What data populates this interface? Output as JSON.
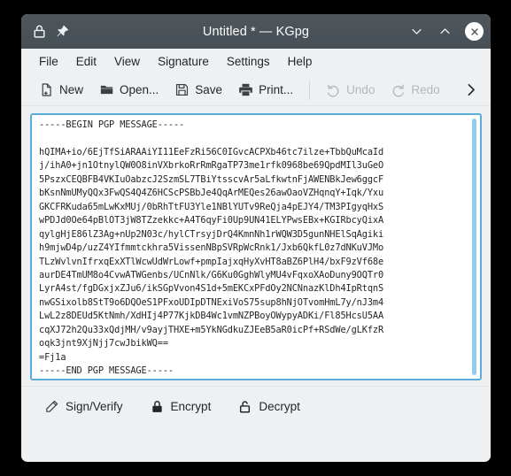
{
  "window": {
    "title": "Untitled * — KGpg",
    "titlebar_icons": [
      "lock-icon",
      "pin-icon"
    ],
    "controls": {
      "minimize": "chevron-down-icon",
      "maximize": "chevron-up-icon",
      "close": "close-icon"
    }
  },
  "menubar": {
    "items": [
      {
        "label": "File"
      },
      {
        "label": "Edit"
      },
      {
        "label": "View"
      },
      {
        "label": "Signature"
      },
      {
        "label": "Settings"
      },
      {
        "label": "Help"
      }
    ]
  },
  "toolbar": {
    "items": [
      {
        "label": "New",
        "icon": "new-document-icon",
        "enabled": true
      },
      {
        "label": "Open...",
        "icon": "folder-open-icon",
        "enabled": true
      },
      {
        "label": "Save",
        "icon": "floppy-disk-icon",
        "enabled": true
      },
      {
        "label": "Print...",
        "icon": "printer-icon",
        "enabled": true
      },
      {
        "label": "Undo",
        "icon": "undo-arrow-icon",
        "enabled": false
      },
      {
        "label": "Redo",
        "icon": "redo-arrow-icon",
        "enabled": false
      }
    ],
    "overflow_icon": "chevron-right-icon"
  },
  "editor": {
    "content": "-----BEGIN PGP MESSAGE-----\n\nhQIMA+io/6EjTfSiARAAiYI11EeFzRi56C0IGvcACPXb46tc7ilze+TbbQuMcaId\nj/ihA0+jn1OtnylQW0O8inVXbrkoRrRmRgaTP73me1rfk0968be69QpdMIl3uGeO\n5PszxCEQBFB4VKIuOabzcJ2SzmSL7TBiYtsscvAr5aLfkwtnFjAWENBkJew6ggcF\nbKsnNmUMyQQx3FwQS4Q4Z6HCScPSBbJe4QqArMEQes26awOaoVZHqnqY+Iqk/Yxu\nGKCFRKuda65mLwKxMUj/0bRhTtFU3Yle1NBlYUTv9ReQja4pEJY4/TM3PIgyqHxS\nwPDJd0Oe64pBlOT3jW8TZzekkc+A4T6qyFi0Up9UN41ELYPwsEBx+KGIRbcyQixA\nqylgHjE86lZ3Ag+nUp2N03c/hylCTrsyjDrQ4KmnNh1rWQW3D5gunNHElSqAgiki\nh9mjwD4p/uzZ4YIfmmtckhra5VissenNBpSVRpWcRnk1/Jxb6QkfL0z7dNKuVJMo\nTLzWvlvnIfrxqExXTlWcwUdWrLowf+pmpIajxqHyXvHT8aBZ6PlH4/bxF9zVf68e\naurDE4TmUM8o4CvwATWGenbs/UCnNlk/G6Ku0GghWlyMU4vFqxoXAoDuny9OQTr0\nLyrA4st/fgDGxjxZJu6/ikSGpVvon4S1d+5mEKCxPFdOy2NCNnazKlDh4IpRtqnS\nnwGSixolb8StT9o6DQOeS1PFxoUDIpDTNExiVoS75sup8hNjOTvomHmL7y/nJ3m4\nLwL2z8DEUd5KtNmh/XdHIj4P77KjkDB4Wc1vmNZPBoyOWypyADKi/Fl85HcsU5AA\ncqXJ72h2Qu33xQdjMH/v9ayjTHXE+m5YkNGdkuZJEeB5aR0icPf+RSdWe/gLKfzR\noqk3jnt9XjNjj7cwJbikWQ==\n=Fj1a\n-----END PGP MESSAGE-----"
  },
  "actionbar": {
    "items": [
      {
        "label": "Sign/Verify",
        "icon": "pencil-icon"
      },
      {
        "label": "Encrypt",
        "icon": "lock-closed-icon"
      },
      {
        "label": "Decrypt",
        "icon": "lock-open-icon"
      }
    ]
  },
  "colors": {
    "titlebar": "#4e565c",
    "window_background": "#eff0f1",
    "editor_border": "#5badde",
    "scrollbar": "#93cdee",
    "text": "#232629",
    "disabled_text": "#b4b7ba"
  }
}
